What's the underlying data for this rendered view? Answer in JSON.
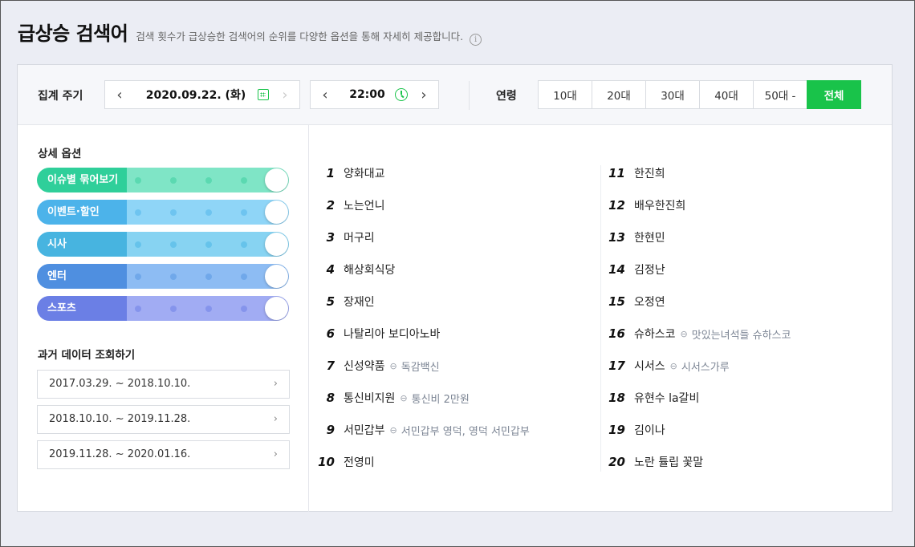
{
  "header": {
    "title": "급상승 검색어",
    "description": "검색 횟수가 급상승한 검색어의 순위를 다양한 옵션을 통해 자세히 제공합니다.",
    "info_icon": "info-icon"
  },
  "filters": {
    "period_label": "집계 주기",
    "date": "2020.09.22. (화)",
    "time": "22:00",
    "age_label": "연령",
    "ages": [
      "10대",
      "20대",
      "30대",
      "40대",
      "50대 -",
      "전체"
    ],
    "selected_age": "전체",
    "accent": "#19c34a"
  },
  "options": {
    "title": "상세 옵션",
    "toggles": [
      {
        "label": "이슈별 묶어보기",
        "color": "#2fcf9a",
        "track": "#7fe5c6",
        "dot": "#5bd9b1"
      },
      {
        "label": "이벤트·할인",
        "color": "#4cb3ea",
        "track": "#8fd5f7",
        "dot": "#6ec4f0"
      },
      {
        "label": "시사",
        "color": "#47b4e0",
        "track": "#87d3f2",
        "dot": "#66c3eb"
      },
      {
        "label": "엔터",
        "color": "#4f8fe0",
        "track": "#8dbcf3",
        "dot": "#70a8ea"
      },
      {
        "label": "스포츠",
        "color": "#6b7fe5",
        "track": "#a1acf3",
        "dot": "#8594ec"
      }
    ]
  },
  "history": {
    "title": "과거 데이터 조회하기",
    "ranges": [
      "2017.03.29. ~ 2018.10.10.",
      "2018.10.10. ~ 2019.11.28.",
      "2019.11.28. ~ 2020.01.16."
    ]
  },
  "ranks": [
    {
      "rank": "1",
      "keyword": "양화대교",
      "related": ""
    },
    {
      "rank": "2",
      "keyword": "노는언니",
      "related": ""
    },
    {
      "rank": "3",
      "keyword": "머구리",
      "related": ""
    },
    {
      "rank": "4",
      "keyword": "해상회식당",
      "related": ""
    },
    {
      "rank": "5",
      "keyword": "장재인",
      "related": ""
    },
    {
      "rank": "6",
      "keyword": "나탈리아 보디아노바",
      "related": ""
    },
    {
      "rank": "7",
      "keyword": "신성약품",
      "related": "독감백신"
    },
    {
      "rank": "8",
      "keyword": "통신비지원",
      "related": "통신비 2만원"
    },
    {
      "rank": "9",
      "keyword": "서민갑부",
      "related": "서민갑부 영덕, 영덕 서민갑부"
    },
    {
      "rank": "10",
      "keyword": "전영미",
      "related": ""
    },
    {
      "rank": "11",
      "keyword": "한진희",
      "related": ""
    },
    {
      "rank": "12",
      "keyword": "배우한진희",
      "related": ""
    },
    {
      "rank": "13",
      "keyword": "한현민",
      "related": ""
    },
    {
      "rank": "14",
      "keyword": "김정난",
      "related": ""
    },
    {
      "rank": "15",
      "keyword": "오정연",
      "related": ""
    },
    {
      "rank": "16",
      "keyword": "슈하스코",
      "related": "맛있는녀석들 슈하스코"
    },
    {
      "rank": "17",
      "keyword": "시서스",
      "related": "시서스가루"
    },
    {
      "rank": "18",
      "keyword": "유현수 la갈비",
      "related": ""
    },
    {
      "rank": "19",
      "keyword": "김이나",
      "related": ""
    },
    {
      "rank": "20",
      "keyword": "노란 튤립 꽃말",
      "related": ""
    }
  ]
}
